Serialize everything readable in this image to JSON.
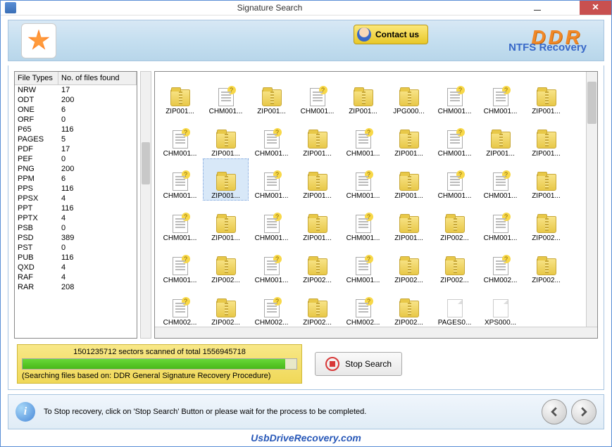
{
  "window": {
    "title": "Signature Search"
  },
  "banner": {
    "contact_label": "Contact us",
    "brand": "DDR",
    "product": "NTFS Recovery"
  },
  "filetypes": {
    "col1": "File Types",
    "col2": "No. of files found",
    "rows": [
      {
        "t": "NRW",
        "n": "17"
      },
      {
        "t": "ODT",
        "n": "200"
      },
      {
        "t": "ONE",
        "n": "6"
      },
      {
        "t": "ORF",
        "n": "0"
      },
      {
        "t": "P65",
        "n": "116"
      },
      {
        "t": "PAGES",
        "n": "5"
      },
      {
        "t": "PDF",
        "n": "17"
      },
      {
        "t": "PEF",
        "n": "0"
      },
      {
        "t": "PNG",
        "n": "200"
      },
      {
        "t": "PPM",
        "n": "6"
      },
      {
        "t": "PPS",
        "n": "116"
      },
      {
        "t": "PPSX",
        "n": "4"
      },
      {
        "t": "PPT",
        "n": "116"
      },
      {
        "t": "PPTX",
        "n": "4"
      },
      {
        "t": "PSB",
        "n": "0"
      },
      {
        "t": "PSD",
        "n": "389"
      },
      {
        "t": "PST",
        "n": "0"
      },
      {
        "t": "PUB",
        "n": "116"
      },
      {
        "t": "QXD",
        "n": "4"
      },
      {
        "t": "RAF",
        "n": "4"
      },
      {
        "t": "RAR",
        "n": "208"
      }
    ]
  },
  "grid": {
    "items": [
      {
        "l": "ZIP001...",
        "i": "zip"
      },
      {
        "l": "CHM001...",
        "i": "doc"
      },
      {
        "l": "ZIP001...",
        "i": "zip"
      },
      {
        "l": "CHM001...",
        "i": "doc"
      },
      {
        "l": "ZIP001...",
        "i": "zip"
      },
      {
        "l": "JPG000...",
        "i": "zip"
      },
      {
        "l": "CHM001...",
        "i": "doc"
      },
      {
        "l": "CHM001...",
        "i": "doc"
      },
      {
        "l": "ZIP001...",
        "i": "zip"
      },
      {
        "l": "CHM001...",
        "i": "doc"
      },
      {
        "l": "ZIP001...",
        "i": "zip"
      },
      {
        "l": "CHM001...",
        "i": "doc"
      },
      {
        "l": "ZIP001...",
        "i": "zip"
      },
      {
        "l": "CHM001...",
        "i": "doc"
      },
      {
        "l": "ZIP001...",
        "i": "zip"
      },
      {
        "l": "CHM001...",
        "i": "doc"
      },
      {
        "l": "ZIP001...",
        "i": "zip"
      },
      {
        "l": "ZIP001...",
        "i": "zip"
      },
      {
        "l": "CHM001...",
        "i": "doc"
      },
      {
        "l": "ZIP001...",
        "i": "zip",
        "sel": true
      },
      {
        "l": "CHM001...",
        "i": "doc"
      },
      {
        "l": "ZIP001...",
        "i": "zip"
      },
      {
        "l": "CHM001...",
        "i": "doc"
      },
      {
        "l": "ZIP001...",
        "i": "zip"
      },
      {
        "l": "CHM001...",
        "i": "doc"
      },
      {
        "l": "CHM001...",
        "i": "doc"
      },
      {
        "l": "ZIP001...",
        "i": "zip"
      },
      {
        "l": "CHM001...",
        "i": "doc"
      },
      {
        "l": "ZIP001...",
        "i": "zip"
      },
      {
        "l": "CHM001...",
        "i": "doc"
      },
      {
        "l": "ZIP001...",
        "i": "zip"
      },
      {
        "l": "CHM001...",
        "i": "doc"
      },
      {
        "l": "ZIP001...",
        "i": "zip"
      },
      {
        "l": "ZIP002...",
        "i": "zip"
      },
      {
        "l": "CHM001...",
        "i": "doc"
      },
      {
        "l": "ZIP002...",
        "i": "zip"
      },
      {
        "l": "CHM001...",
        "i": "doc"
      },
      {
        "l": "ZIP002...",
        "i": "zip"
      },
      {
        "l": "CHM001...",
        "i": "doc"
      },
      {
        "l": "ZIP002...",
        "i": "zip"
      },
      {
        "l": "CHM001...",
        "i": "doc"
      },
      {
        "l": "ZIP002...",
        "i": "zip"
      },
      {
        "l": "ZIP002...",
        "i": "zip"
      },
      {
        "l": "CHM002...",
        "i": "doc"
      },
      {
        "l": "ZIP002...",
        "i": "zip"
      },
      {
        "l": "CHM002...",
        "i": "doc"
      },
      {
        "l": "ZIP002...",
        "i": "zip"
      },
      {
        "l": "CHM002...",
        "i": "doc"
      },
      {
        "l": "ZIP002...",
        "i": "zip"
      },
      {
        "l": "CHM002...",
        "i": "doc"
      },
      {
        "l": "ZIP002...",
        "i": "zip"
      },
      {
        "l": "PAGES0...",
        "i": "blank"
      },
      {
        "l": "XPS000...",
        "i": "blank"
      }
    ]
  },
  "progress": {
    "sectors_text": "1501235712 sectors scanned of total 1556945718",
    "percent": 96,
    "procedure_text": "(Searching files based on:  DDR General Signature Recovery Procedure)",
    "stop_label": "Stop Search"
  },
  "footer": {
    "hint": "To Stop recovery, click on 'Stop Search' Button or please wait for the process to be completed."
  },
  "website": "UsbDriveRecovery.com"
}
